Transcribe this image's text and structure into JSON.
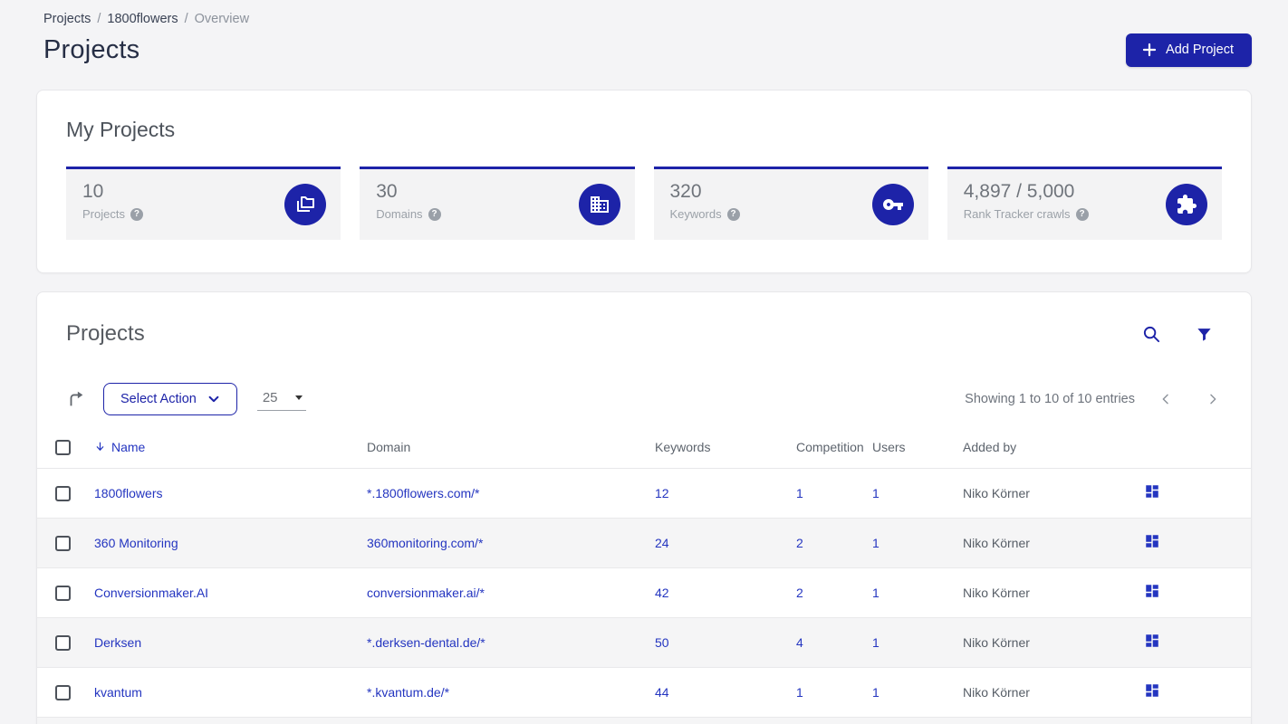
{
  "colors": {
    "brand": "#1d23a8",
    "link": "#2435c0",
    "page_bg": "#f4f4f6",
    "card_bg": "#ffffff",
    "stat_bg": "#f3f3f4",
    "row_alt_bg": "#f5f5f6"
  },
  "breadcrumb": {
    "separator": "/",
    "items": [
      {
        "label": "Projects"
      },
      {
        "label": "1800flowers"
      },
      {
        "label": "Overview"
      }
    ]
  },
  "page": {
    "title": "Projects"
  },
  "header": {
    "add_project_label": "Add Project"
  },
  "icons": {
    "add": "plus",
    "search": "magnifier",
    "filter": "funnel",
    "bulk_action": "forward-arrow",
    "sort": "arrow-down",
    "help": "question-circle",
    "prev": "chevron-left",
    "next": "chevron-right",
    "row_action": "dashboard-grid",
    "stat_icons": [
      "stacked-folders",
      "building",
      "key",
      "puzzle-piece"
    ]
  },
  "my_projects": {
    "title": "My Projects",
    "stats": [
      {
        "value": "10",
        "label": "Projects"
      },
      {
        "value": "30",
        "label": "Domains"
      },
      {
        "value": "320",
        "label": "Keywords"
      },
      {
        "value": "4,897 / 5,000",
        "label": "Rank Tracker crawls"
      }
    ]
  },
  "projects_table": {
    "title": "Projects",
    "select_action_label": "Select Action",
    "page_size": "25",
    "showing_text": "Showing 1 to 10 of 10 entries",
    "columns": {
      "name": "Name",
      "domain": "Domain",
      "keywords": "Keywords",
      "competition": "Competition",
      "users": "Users",
      "added_by": "Added by"
    },
    "rows": [
      {
        "name": "1800flowers",
        "domain": "*.1800flowers.com/*",
        "keywords": "12",
        "competition": "1",
        "users": "1",
        "added_by": "Niko Körner"
      },
      {
        "name": "360 Monitoring",
        "domain": "360monitoring.com/*",
        "keywords": "24",
        "competition": "2",
        "users": "1",
        "added_by": "Niko Körner"
      },
      {
        "name": "Conversionmaker.AI",
        "domain": "conversionmaker.ai/*",
        "keywords": "42",
        "competition": "2",
        "users": "1",
        "added_by": "Niko Körner"
      },
      {
        "name": "Derksen",
        "domain": "*.derksen-dental.de/*",
        "keywords": "50",
        "competition": "4",
        "users": "1",
        "added_by": "Niko Körner"
      },
      {
        "name": "kvantum",
        "domain": "*.kvantum.de/*",
        "keywords": "44",
        "competition": "1",
        "users": "1",
        "added_by": "Niko Körner"
      }
    ]
  }
}
